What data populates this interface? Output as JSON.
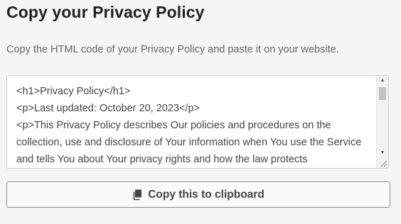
{
  "page": {
    "title": "Copy your Privacy Policy",
    "description": "Copy the HTML code of your Privacy Policy and paste it on your website."
  },
  "code_box": {
    "content": "<h1>Privacy Policy</h1>\n<p>Last updated: October 20, 2023</p>\n<p>This Privacy Policy describes Our policies and procedures on the collection, use and disclosure of Your information when You use the Service and tells You about Your privacy rights and how the law protects"
  },
  "copy_button": {
    "label": "Copy this to clipboard",
    "icon": "copy-icon"
  },
  "colors": {
    "background": "#f5f5f5",
    "text_primary": "#222222",
    "text_secondary": "#666666",
    "border": "#cfcfcf",
    "button_border": "#8c8c8c"
  }
}
